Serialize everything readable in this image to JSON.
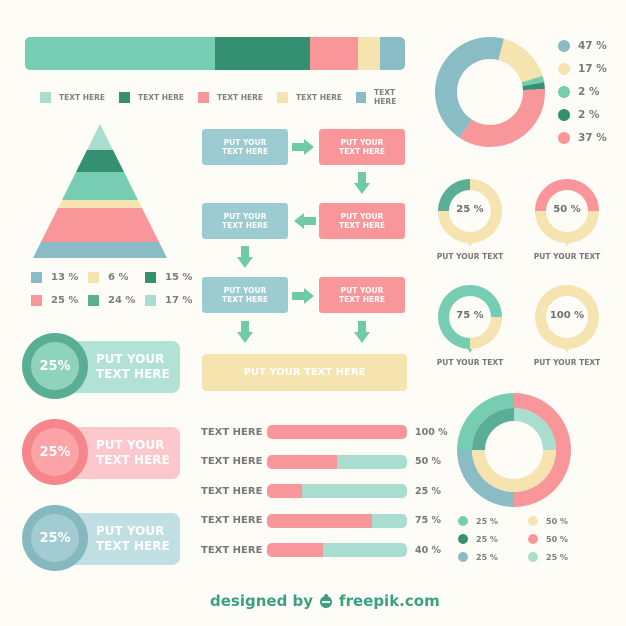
{
  "colors": {
    "mint": "#77cdb2",
    "dark_green": "#358f71",
    "pink": "#f9969a",
    "yellow": "#f5e4b0",
    "blue": "#89bcc4",
    "light_mint": "#a9ddcf",
    "mid_green": "#5aae93"
  },
  "stack_bar": {
    "segments": [
      {
        "name": "mint",
        "value": 50,
        "color": "#77cdb2"
      },
      {
        "name": "dark-green",
        "value": 25,
        "color": "#358f71"
      },
      {
        "name": "pink",
        "value": 12.5,
        "color": "#f9969a"
      },
      {
        "name": "yellow",
        "value": 6,
        "color": "#f5e4b0"
      },
      {
        "name": "blue",
        "value": 6.5,
        "color": "#89bcc4"
      }
    ],
    "legend": [
      {
        "label": "TEXT HERE",
        "color": "#a9ddcf"
      },
      {
        "label": "TEXT HERE",
        "color": "#358f71"
      },
      {
        "label": "TEXT HERE",
        "color": "#f9969a"
      },
      {
        "label": "TEXT HERE",
        "color": "#f5e4b0"
      },
      {
        "label": "TEXT HERE",
        "color": "#89bcc4"
      }
    ]
  },
  "top_donut": {
    "segments": [
      {
        "label": "47 %",
        "value": 47,
        "color": "#89bcc4"
      },
      {
        "label": "17 %",
        "value": 17,
        "color": "#f5e4b0"
      },
      {
        "label": "2 %",
        "value": 2,
        "color": "#77cdb2"
      },
      {
        "label": "2 %",
        "value": 2,
        "color": "#358f71"
      },
      {
        "label": "37 %",
        "value": 37,
        "color": "#f9969a"
      }
    ]
  },
  "pyramid": {
    "bands": [
      {
        "label": "17 %",
        "color": "#a9ddcf"
      },
      {
        "label": "15 %",
        "color": "#358f71"
      },
      {
        "label": "24 %",
        "color": "#77cdb2"
      },
      {
        "label": "6 %",
        "color": "#f5e4b0"
      },
      {
        "label": "25 %",
        "color": "#f9969a"
      },
      {
        "label": "13 %",
        "color": "#89bcc4"
      }
    ],
    "legend": [
      {
        "label": "13 %",
        "color": "#89bcc4"
      },
      {
        "label": "6 %",
        "color": "#f5e4b0"
      },
      {
        "label": "15 %",
        "color": "#358f71"
      },
      {
        "label": "25 %",
        "color": "#f9969a"
      },
      {
        "label": "24 %",
        "color": "#5aae93"
      },
      {
        "label": "17 %",
        "color": "#a9ddcf"
      }
    ]
  },
  "flow": {
    "box_line1": "PUT YOUR",
    "box_line2": "TEXT HERE",
    "final": "PUT YOUR  TEXT HERE"
  },
  "rings": [
    {
      "value": 25,
      "label": "25 %",
      "caption": "PUT YOUR  TEXT",
      "color": "#5aae93"
    },
    {
      "value": 50,
      "label": "50 %",
      "caption": "PUT YOUR  TEXT",
      "color": "#f9969a"
    },
    {
      "value": 75,
      "label": "75 %",
      "caption": "PUT YOUR  TEXT",
      "color": "#77cdb2"
    },
    {
      "value": 100,
      "label": "100 %",
      "caption": "PUT YOUR  TEXT",
      "color": "#f5e4b0"
    }
  ],
  "pills": [
    {
      "value": "25%",
      "line1": "PUT YOUR",
      "line2": "TEXT HERE",
      "bg": "#b2e2d4",
      "ring": "#5aae93",
      "inner": "#8fd3bd"
    },
    {
      "value": "25%",
      "line1": "PUT YOUR",
      "line2": "TEXT HERE",
      "bg": "#fcc8cb",
      "ring": "#f5868b",
      "inner": "#fba3a7"
    },
    {
      "value": "25%",
      "line1": "PUT YOUR",
      "line2": "TEXT HERE",
      "bg": "#c0dfe3",
      "ring": "#86b8bf",
      "inner": "#a3ccd2"
    }
  ],
  "progress": [
    {
      "label": "TEXT HERE",
      "value": 100,
      "text": "100 %"
    },
    {
      "label": "TEXT HERE",
      "value": 50,
      "text": "50 %"
    },
    {
      "label": "TEXT HERE",
      "value": 25,
      "text": "25 %"
    },
    {
      "label": "TEXT HERE",
      "value": 75,
      "text": "75 %"
    },
    {
      "label": "TEXT HERE",
      "value": 40,
      "text": "40 %"
    }
  ],
  "double_donut": {
    "outer": [
      {
        "value": 25,
        "color": "#77cdb2",
        "label": "25 %"
      },
      {
        "value": 50,
        "color": "#f9969a",
        "label": "50 %"
      },
      {
        "value": 25,
        "color": "#89bcc4",
        "label": "25 %"
      }
    ],
    "inner": [
      {
        "value": 25,
        "color": "#5aae93",
        "label": "25 %"
      },
      {
        "value": 25,
        "color": "#a9ddcf",
        "label": "25 %"
      },
      {
        "value": 50,
        "color": "#f5e4b0",
        "label": "50 %"
      }
    ],
    "legend": [
      {
        "label": "25 %",
        "color": "#77cdb2"
      },
      {
        "label": "50 %",
        "color": "#f5e4b0"
      },
      {
        "label": "25 %",
        "color": "#358f71"
      },
      {
        "label": "50 %",
        "color": "#f9969a"
      },
      {
        "label": "25 %",
        "color": "#89bcc4"
      },
      {
        "label": "25 %",
        "color": "#a9ddcf"
      }
    ]
  },
  "credit": {
    "prefix": "designed by",
    "brand": "freepik.com"
  }
}
